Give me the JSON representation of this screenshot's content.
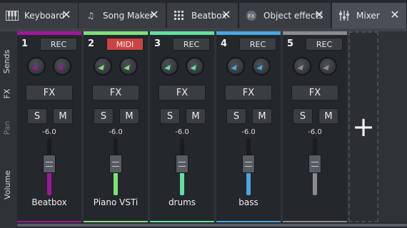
{
  "tabs": [
    {
      "label": "Keyboard",
      "icon": "piano-keys-icon"
    },
    {
      "label": "Song Maker",
      "icon": "music-note-icon"
    },
    {
      "label": "Beatbox",
      "icon": "drum-pad-grid-icon"
    },
    {
      "label": "Object effects",
      "icon": "fx-badge-icon"
    },
    {
      "label": "Mixer",
      "icon": "mixer-sliders-icon",
      "active": true
    }
  ],
  "side_labels": {
    "sends": "Sends",
    "fx": "FX",
    "pan": "Pan",
    "volume": "Volume"
  },
  "strips": [
    {
      "number": "1",
      "rec": "REC",
      "fx": "FX",
      "solo": "S",
      "mute": "M",
      "volume": "-6.0",
      "name": "Beatbox",
      "color": "#a0179c",
      "level": 0.45
    },
    {
      "number": "2",
      "rec": "MIDI",
      "fx": "FX",
      "solo": "S",
      "mute": "M",
      "volume": "-6.0",
      "name": "Piano VSTi",
      "color": "#7ee07a",
      "level": 0.45
    },
    {
      "number": "3",
      "rec": "REC",
      "fx": "FX",
      "solo": "S",
      "mute": "M",
      "volume": "-6.0",
      "name": "drums",
      "color": "#62dfa0",
      "level": 0.45
    },
    {
      "number": "4",
      "rec": "REC",
      "fx": "FX",
      "solo": "S",
      "mute": "M",
      "volume": "-6.0",
      "name": "bass",
      "color": "#4aa6e0",
      "level": 0.45
    },
    {
      "number": "5",
      "rec": "REC",
      "fx": "FX",
      "solo": "S",
      "mute": "M",
      "volume": "-6.0",
      "name": "",
      "color": "#8c8c8c",
      "level": 0.45
    }
  ],
  "add_label": "+"
}
